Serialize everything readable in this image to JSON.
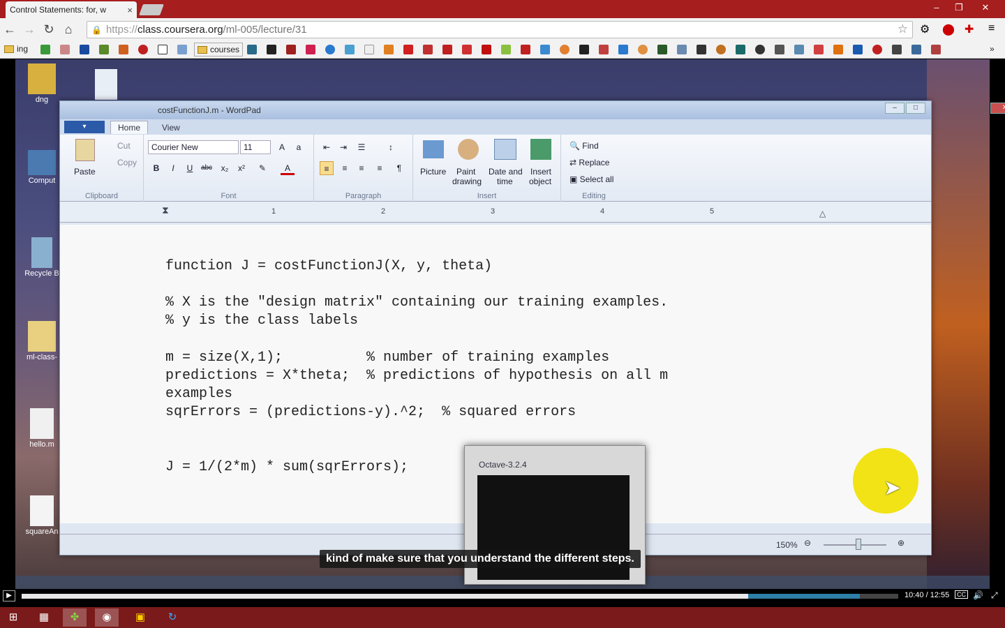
{
  "browser": {
    "tab_title": "Control Statements: for, w",
    "tab_close": "×",
    "url_prefix": "https://",
    "url_host": "class.coursera.org",
    "url_path": "/ml-005/lecture/31",
    "bookmarks": [
      {
        "label": "ing"
      },
      {
        "label": "courses"
      }
    ]
  },
  "desktop": {
    "icons": [
      {
        "label": "dng"
      },
      {
        "label": "Comput"
      },
      {
        "label": "Recycle B"
      },
      {
        "label": "ml-class-"
      },
      {
        "label": "hello.m"
      },
      {
        "label": "squareAn"
      }
    ]
  },
  "wordpad": {
    "title": "costFunctionJ.m - WordPad",
    "file_menu": "▾",
    "tabs": {
      "home": "Home",
      "view": "View"
    },
    "clipboard": {
      "paste": "Paste",
      "cut": "Cut",
      "copy": "Copy",
      "group": "Clipboard"
    },
    "font": {
      "family": "Courier New",
      "size": "11",
      "group": "Font"
    },
    "paragraph": {
      "group": "Paragraph"
    },
    "insert": {
      "picture": "Picture",
      "paint1": "Paint",
      "paint2": "drawing",
      "date1": "Date and",
      "date2": "time",
      "obj1": "Insert",
      "obj2": "object",
      "group": "Insert"
    },
    "editing": {
      "find": "Find",
      "replace": "Replace",
      "select_all": "Select all",
      "group": "Editing"
    },
    "ruler": [
      "1",
      "2",
      "3",
      "4",
      "5"
    ],
    "code": [
      "function J = costFunctionJ(X, y, theta)",
      "% X is the \"design matrix\" containing our training examples.",
      "% y is the class labels",
      "m = size(X,1);          % number of training examples",
      "predictions = X*theta;  % predictions of hypothesis on all m",
      "examples",
      "sqrErrors = (predictions-y).^2;  % squared errors",
      "J = 1/(2*m) * sum(sqrErrors);"
    ],
    "zoom": "150%"
  },
  "octave": {
    "title": "Octave-3.2.4"
  },
  "caption": "kind of make sure that you understand the different steps.",
  "player": {
    "time": "10:40 / 12:55",
    "played_fraction": 0.829,
    "buffered_fraction": 0.956,
    "cc": "CC"
  },
  "colors": {
    "chrome_red": "#a61e1e",
    "taskbar_red": "#7a1a1a",
    "highlight": "#f0e20a"
  }
}
